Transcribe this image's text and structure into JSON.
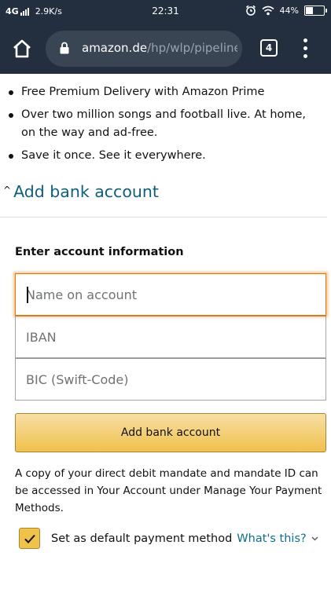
{
  "status_bar": {
    "network": "4G",
    "speed": "2.9K/s",
    "time": "22:31",
    "battery_text": "44%",
    "battery_level": 0.44
  },
  "toolbar": {
    "url_domain": "amazon.de",
    "url_path": "/hp/wlp/pipeline/mo",
    "tab_count": "4"
  },
  "benefits": [
    "Free Premium Delivery with Amazon Prime",
    "Over two million songs and football live. At home, on the way and ad-free.",
    "Save it once. See it everywhere."
  ],
  "section": {
    "title": "Add bank account"
  },
  "form": {
    "label": "Enter account information",
    "name_placeholder": "Name on account",
    "iban_placeholder": "IBAN",
    "bic_placeholder": "BIC (Swift-Code)",
    "submit_label": "Add bank account",
    "note": "A copy of your direct debit mandate and mandate ID can be accessed in Your Account under Manage Your Payment Methods.",
    "default_label": "Set as default payment method",
    "whats_this": "What's this?",
    "default_checked": true
  },
  "colors": {
    "header_bg": "#232f3e",
    "link": "#0f6d8d",
    "button": "#f0c14b",
    "focus": "#e77600"
  },
  "icons": {
    "home": "home-icon",
    "lock": "lock-icon",
    "menu": "more-vert-icon",
    "alarm": "alarm-icon",
    "wifi": "wifi-icon",
    "check": "check-icon",
    "chevron": "chevron-down-icon"
  }
}
